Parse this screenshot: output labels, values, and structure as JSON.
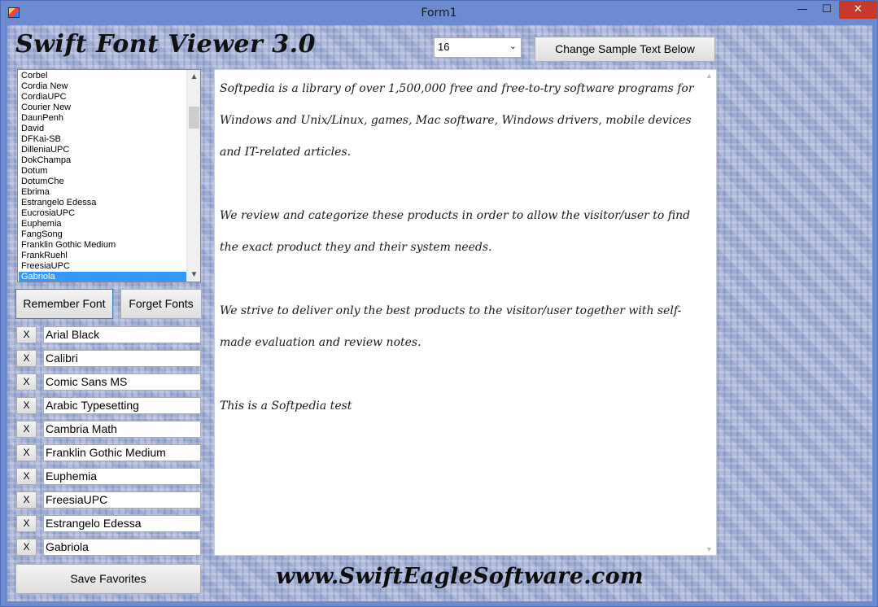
{
  "window": {
    "title": "Form1",
    "min_glyph": "—",
    "max_glyph": "☐",
    "close_glyph": "✕"
  },
  "app": {
    "title": "Swift Font Viewer 3.0",
    "website": "www.SwiftEagleSoftware.com"
  },
  "toolbar": {
    "font_size_value": "16",
    "change_sample_label": "Change Sample Text Below"
  },
  "font_list": {
    "items": [
      "Corbel",
      "Cordia New",
      "CordiaUPC",
      "Courier New",
      "DaunPenh",
      "David",
      "DFKai-SB",
      "DilleniaUPC",
      "DokChampa",
      "Dotum",
      "DotumChe",
      "Ebrima",
      "Estrangelo Edessa",
      "EucrosiaUPC",
      "Euphemia",
      "FangSong",
      "Franklin Gothic Medium",
      "FrankRuehl",
      "FreesiaUPC",
      "Gabriola"
    ],
    "selected_index": 19
  },
  "buttons": {
    "remember_label": "Remember Font",
    "forget_label": "Forget Fonts",
    "save_label": "Save Favorites",
    "remove_label": "X"
  },
  "favorites": [
    "Arial Black",
    "Calibri",
    "Comic Sans MS",
    "Arabic Typesetting",
    "Cambria Math",
    "Franklin Gothic Medium",
    "Euphemia",
    "FreesiaUPC",
    "Estrangelo Edessa",
    "Gabriola"
  ],
  "sample_text": {
    "para1": "Softpedia is a library of over 1,500,000 free and free-to-try software programs for Windows and Unix/Linux, games, Mac software, Windows drivers, mobile devices and IT-related articles.",
    "para2": "We review and categorize these products in order to allow the visitor/user to find the exact product they and their system needs.",
    "para3": "We strive to deliver only the best products to the visitor/user together with self-made evaluation and review notes.",
    "para4": "This is a Softpedia test"
  },
  "colors": {
    "selection": "#3399ff",
    "close_button": "#c7392c",
    "title_bar": "#6d8bd0"
  }
}
